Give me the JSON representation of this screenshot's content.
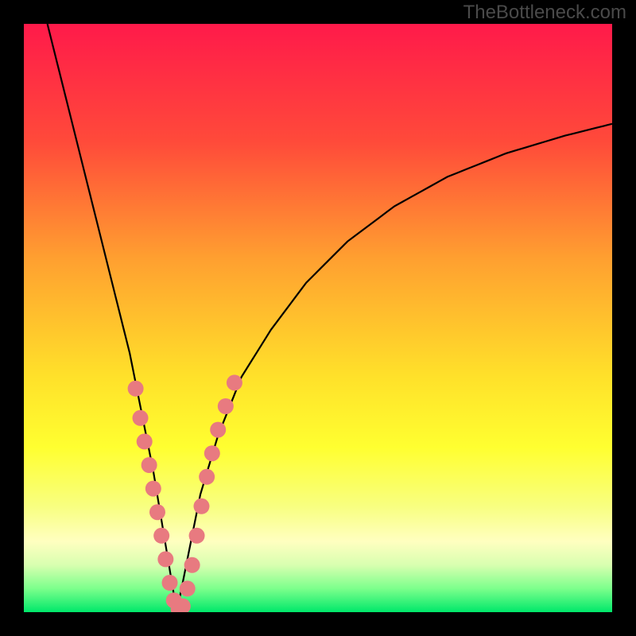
{
  "watermark": "TheBottleneck.com",
  "chart_data": {
    "type": "line",
    "title": "",
    "xlabel": "",
    "ylabel": "",
    "xlim": [
      0,
      100
    ],
    "ylim": [
      0,
      100
    ],
    "background_gradient": {
      "stops": [
        {
          "offset": 0.0,
          "color": "#ff1a4a"
        },
        {
          "offset": 0.2,
          "color": "#ff4a3a"
        },
        {
          "offset": 0.4,
          "color": "#ffa030"
        },
        {
          "offset": 0.6,
          "color": "#ffe12a"
        },
        {
          "offset": 0.72,
          "color": "#ffff30"
        },
        {
          "offset": 0.82,
          "color": "#f8ff80"
        },
        {
          "offset": 0.88,
          "color": "#ffffc0"
        },
        {
          "offset": 0.92,
          "color": "#d8ffb0"
        },
        {
          "offset": 0.96,
          "color": "#7cff8c"
        },
        {
          "offset": 1.0,
          "color": "#00e86a"
        }
      ]
    },
    "curve": {
      "min_x": 26,
      "left": [
        {
          "x": 4,
          "y": 100
        },
        {
          "x": 6,
          "y": 92
        },
        {
          "x": 8,
          "y": 84
        },
        {
          "x": 10,
          "y": 76
        },
        {
          "x": 12,
          "y": 68
        },
        {
          "x": 14,
          "y": 60
        },
        {
          "x": 16,
          "y": 52
        },
        {
          "x": 18,
          "y": 44
        },
        {
          "x": 20,
          "y": 34
        },
        {
          "x": 22,
          "y": 24
        },
        {
          "x": 24,
          "y": 12
        },
        {
          "x": 26,
          "y": 0
        }
      ],
      "right": [
        {
          "x": 26,
          "y": 0
        },
        {
          "x": 28,
          "y": 10
        },
        {
          "x": 30,
          "y": 20
        },
        {
          "x": 33,
          "y": 30
        },
        {
          "x": 37,
          "y": 40
        },
        {
          "x": 42,
          "y": 48
        },
        {
          "x": 48,
          "y": 56
        },
        {
          "x": 55,
          "y": 63
        },
        {
          "x": 63,
          "y": 69
        },
        {
          "x": 72,
          "y": 74
        },
        {
          "x": 82,
          "y": 78
        },
        {
          "x": 92,
          "y": 81
        },
        {
          "x": 100,
          "y": 83
        }
      ]
    },
    "markers": {
      "color": "#e87a80",
      "radius": 10,
      "points": [
        {
          "x": 19.0,
          "y": 38
        },
        {
          "x": 19.8,
          "y": 33
        },
        {
          "x": 20.5,
          "y": 29
        },
        {
          "x": 21.3,
          "y": 25
        },
        {
          "x": 22.0,
          "y": 21
        },
        {
          "x": 22.7,
          "y": 17
        },
        {
          "x": 23.4,
          "y": 13
        },
        {
          "x": 24.1,
          "y": 9
        },
        {
          "x": 24.8,
          "y": 5
        },
        {
          "x": 25.5,
          "y": 2
        },
        {
          "x": 26.3,
          "y": 0.5
        },
        {
          "x": 27.0,
          "y": 1
        },
        {
          "x": 27.8,
          "y": 4
        },
        {
          "x": 28.6,
          "y": 8
        },
        {
          "x": 29.4,
          "y": 13
        },
        {
          "x": 30.2,
          "y": 18
        },
        {
          "x": 31.1,
          "y": 23
        },
        {
          "x": 32.0,
          "y": 27
        },
        {
          "x": 33.0,
          "y": 31
        },
        {
          "x": 34.3,
          "y": 35
        },
        {
          "x": 35.8,
          "y": 39
        }
      ]
    }
  }
}
